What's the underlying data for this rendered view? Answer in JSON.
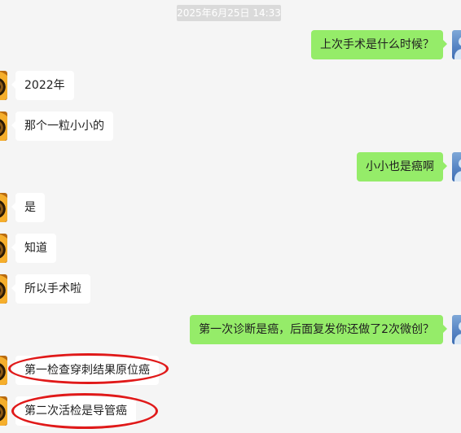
{
  "chat": {
    "timestamp": "2025年6月25日 14:33",
    "messages": [
      {
        "side": "right",
        "text": "上次手术是什么时候？"
      },
      {
        "side": "left",
        "text": "2022年"
      },
      {
        "side": "left",
        "text": "那个一粒小小的"
      },
      {
        "side": "right",
        "text": "小小也是癌啊"
      },
      {
        "side": "left",
        "text": "是"
      },
      {
        "side": "left",
        "text": "知道"
      },
      {
        "side": "left",
        "text": "所以手术啦"
      },
      {
        "side": "right",
        "text": "第一次诊断是癌，后面复发你还做了2次微创？"
      },
      {
        "side": "left",
        "text": "第一检查穿刺结果原位癌"
      },
      {
        "side": "left",
        "text": "第二次活检是导管癌"
      }
    ]
  },
  "colors": {
    "background": "#f5f5f5",
    "sent_bubble": "#95ec69",
    "received_bubble": "#ffffff",
    "annotation_circle": "#e01919"
  },
  "icons": {
    "left_avatar": "person-avatar-icon",
    "right_avatar": "person-avatar-icon"
  }
}
